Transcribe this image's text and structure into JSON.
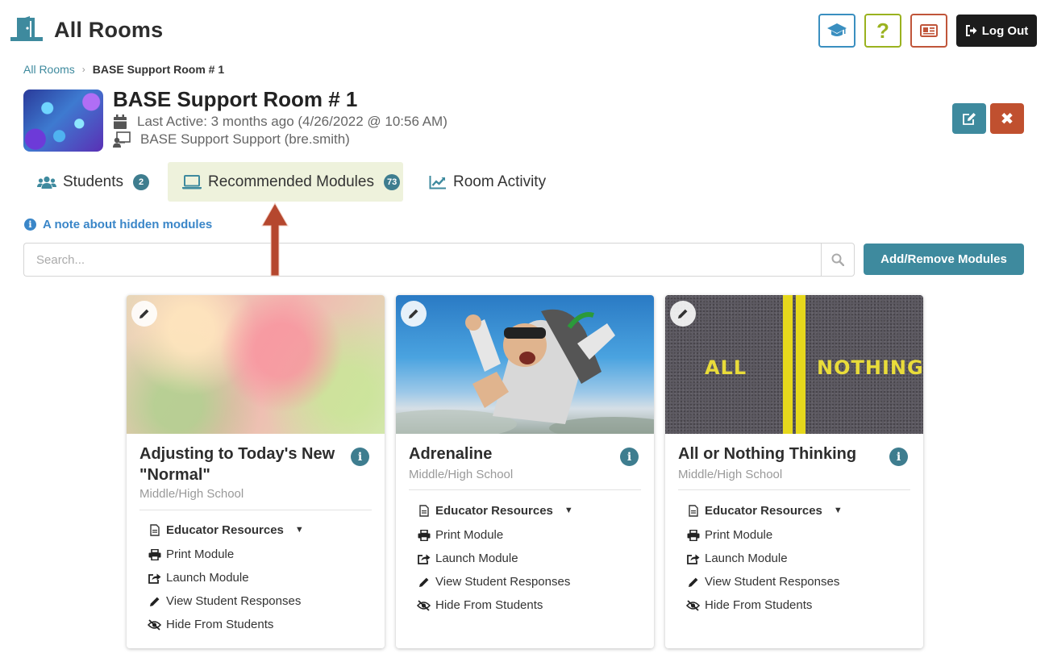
{
  "header": {
    "title": "All Rooms",
    "help_label": "?",
    "logout_label": "Log Out"
  },
  "breadcrumb": {
    "root": "All Rooms",
    "separator": "›",
    "current": "BASE Support Room # 1"
  },
  "room": {
    "title": "BASE Support Room # 1",
    "last_active": "Last Active: 3 months ago (4/26/2022 @ 10:56 AM)",
    "owner": "BASE Support Support (bre.smith)"
  },
  "tabs": [
    {
      "label": "Students",
      "count": "2",
      "icon": "users-icon"
    },
    {
      "label": "Recommended Modules",
      "count": "73",
      "icon": "laptop-icon",
      "active": true
    },
    {
      "label": "Room Activity",
      "icon": "chart-line-icon"
    }
  ],
  "note": {
    "text": "A note about hidden modules"
  },
  "search": {
    "placeholder": "Search...",
    "value": ""
  },
  "add_remove_label": "Add/Remove Modules",
  "cards": [
    {
      "title": "Adjusting to Today's New \"Normal\"",
      "grade": "Middle/High School",
      "actions": {
        "resources": "Educator Resources",
        "print": "Print Module",
        "launch": "Launch Module",
        "view": "View Student Responses",
        "hide": "Hide From Students"
      }
    },
    {
      "title": "Adrenaline",
      "grade": "Middle/High School",
      "actions": {
        "resources": "Educator Resources",
        "print": "Print Module",
        "launch": "Launch Module",
        "view": "View Student Responses",
        "hide": "Hide From Students"
      }
    },
    {
      "title": "All or Nothing Thinking",
      "grade": "Middle/High School",
      "image_text": [
        "ALL",
        "NOTHING"
      ],
      "actions": {
        "resources": "Educator Resources",
        "print": "Print Module",
        "launch": "Launch Module",
        "view": "View Student Responses",
        "hide": "Hide From Students"
      }
    }
  ],
  "colors": {
    "teal": "#3e8a9e",
    "badge": "#3e7d8f",
    "danger": "#c0502f",
    "active_tab_bg": "#eef2dc",
    "link_blue": "#3a86c8",
    "annotation_arrow": "#b5472e"
  }
}
